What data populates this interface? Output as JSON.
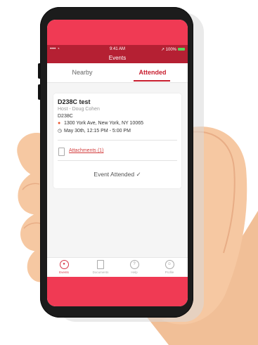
{
  "status_bar": {
    "signal": "•••• ◔",
    "time": "9:41 AM",
    "battery": "↗ 100%"
  },
  "header": {
    "title": "Events"
  },
  "tabs": [
    {
      "label": "Nearby"
    },
    {
      "label": "Attended"
    }
  ],
  "event": {
    "title": "D238C test",
    "host": "Host - Doug Cohen",
    "code": "D238C",
    "address": "1300 York Ave, New York, NY 10065",
    "datetime": "May 30th, 12:15 PM - 5:00 PM",
    "attachments": "Attachments (1)",
    "attended": "Event Attended ✓"
  },
  "nav": [
    {
      "label": "Events",
      "icon": "events-icon"
    },
    {
      "label": "Documents",
      "icon": "documents-icon"
    },
    {
      "label": "Help",
      "icon": "help-icon"
    },
    {
      "label": "Profile",
      "icon": "profile-icon"
    }
  ],
  "icons": {
    "location": "location-pin-icon",
    "clock": "clock-icon",
    "attachment": "document-icon"
  },
  "colors": {
    "brand_red": "#f03a54",
    "dark_red": "#b52033",
    "accent": "#c81e2e",
    "skin": "#f6c8a2"
  }
}
